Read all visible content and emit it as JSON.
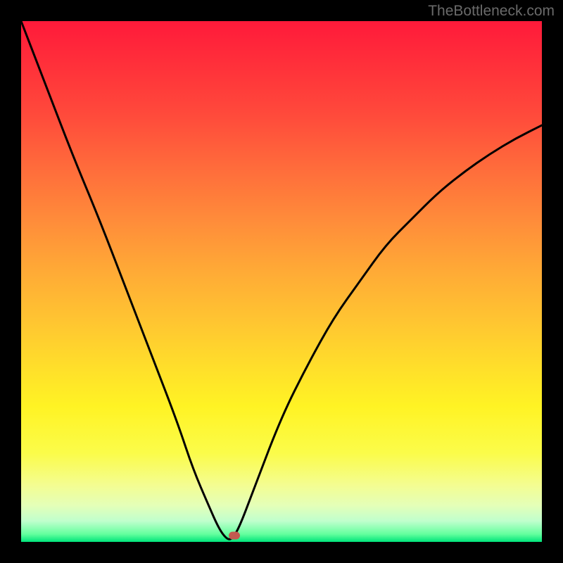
{
  "watermark": "TheBottleneck.com",
  "chart_data": {
    "type": "line",
    "title": "",
    "xlabel": "",
    "ylabel": "",
    "xlim": [
      0,
      100
    ],
    "ylim": [
      0,
      100
    ],
    "series": [
      {
        "name": "bottleneck-curve",
        "x": [
          0,
          5,
          10,
          15,
          20,
          25,
          30,
          33,
          36,
          38,
          39.5,
          40.5,
          42,
          45,
          50,
          55,
          60,
          65,
          70,
          75,
          80,
          85,
          90,
          95,
          100
        ],
        "y": [
          100,
          87,
          74,
          62,
          49,
          36,
          23,
          14,
          7,
          2.5,
          0.5,
          0.5,
          3,
          11,
          24,
          34,
          43,
          50,
          57,
          62,
          67,
          71,
          74.5,
          77.5,
          80
        ]
      }
    ],
    "marker": {
      "x": 41,
      "y": 1.2
    },
    "gradient_stops": [
      {
        "pct": 0,
        "color": "#ff1a3a"
      },
      {
        "pct": 50,
        "color": "#ffaa36"
      },
      {
        "pct": 75,
        "color": "#fff324"
      },
      {
        "pct": 100,
        "color": "#00e47a"
      }
    ]
  }
}
